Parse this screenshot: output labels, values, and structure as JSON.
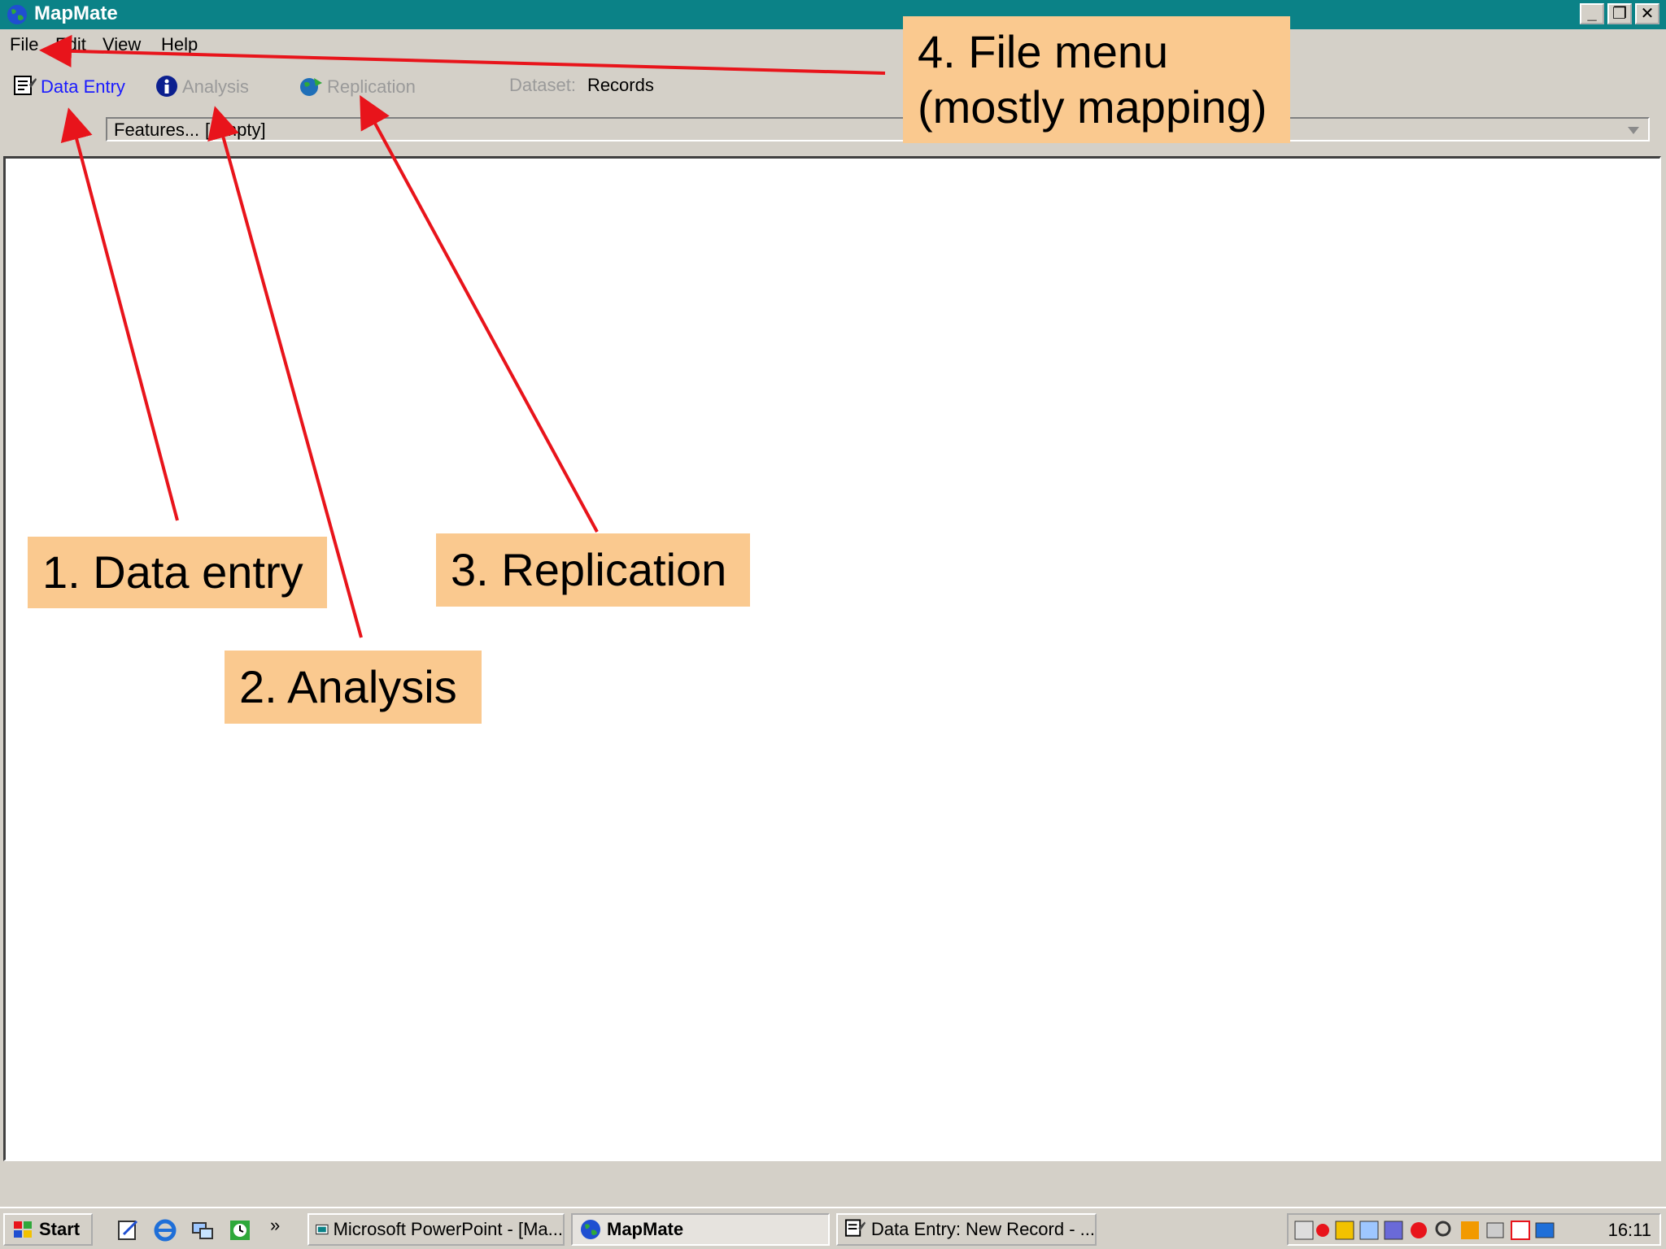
{
  "window": {
    "title": "MapMate",
    "buttons": {
      "minimize": "_",
      "restore": "❐",
      "close": "✕"
    }
  },
  "menu": [
    "File",
    "Edit",
    "View",
    "Help"
  ],
  "toolbar": {
    "data_entry": "Data Entry",
    "analysis": "Analysis",
    "replication": "Replication",
    "dataset_label": "Dataset:",
    "dataset_value": "Records"
  },
  "features": {
    "label": "Features...",
    "value": "[Empty]"
  },
  "taskbar": {
    "start": "Start",
    "overflow": "»",
    "tasks": [
      {
        "label": "Microsoft PowerPoint - [Ma..."
      },
      {
        "label": "MapMate"
      },
      {
        "label": "Data Entry: New Record - ..."
      }
    ],
    "clock": "16:11"
  },
  "callouts": {
    "data_entry": "1. Data entry",
    "analysis": "2. Analysis",
    "replication": "3. Replication",
    "file_menu_line1": "4. File menu",
    "file_menu_line2": "(mostly mapping)"
  },
  "colors": {
    "titlebar": "#0b8287",
    "callout": "#fac98f",
    "arrow": "#e8141b",
    "link_active": "#1a1aff",
    "link_disabled": "#9a9a9a"
  }
}
